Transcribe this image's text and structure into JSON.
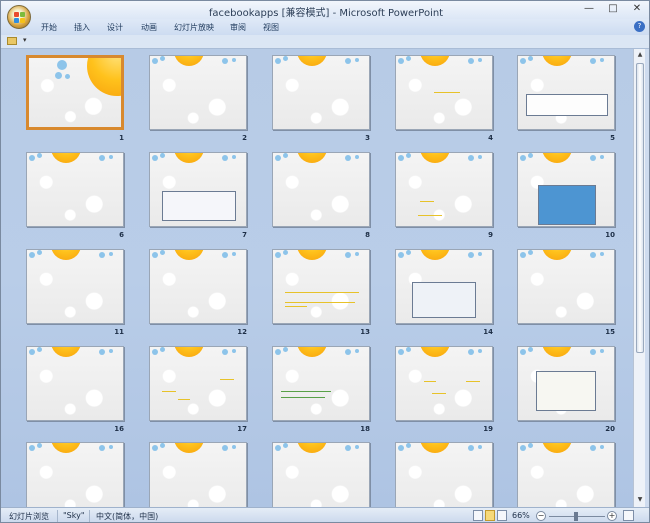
{
  "window": {
    "title": "facebookapps [兼容模式] - Microsoft PowerPoint",
    "controls": [
      "—",
      "□",
      "✕"
    ]
  },
  "ribbon": {
    "tabs": [
      "开始",
      "插入",
      "设计",
      "动画",
      "幻灯片放映",
      "审阅",
      "视图"
    ],
    "help_label": "?"
  },
  "qat": {
    "dropdown_label": "▾"
  },
  "sorter": {
    "selected": 1,
    "slides": [
      {
        "num": "1"
      },
      {
        "num": "2"
      },
      {
        "num": "3"
      },
      {
        "num": "4"
      },
      {
        "num": "5"
      },
      {
        "num": "6"
      },
      {
        "num": "7"
      },
      {
        "num": "8"
      },
      {
        "num": "9"
      },
      {
        "num": "10"
      },
      {
        "num": "11"
      },
      {
        "num": "12"
      },
      {
        "num": "13"
      },
      {
        "num": "14"
      },
      {
        "num": "15"
      },
      {
        "num": "16"
      },
      {
        "num": "17"
      },
      {
        "num": "18"
      },
      {
        "num": "19"
      },
      {
        "num": "20"
      },
      {
        "num": ""
      },
      {
        "num": ""
      },
      {
        "num": ""
      },
      {
        "num": ""
      },
      {
        "num": ""
      }
    ]
  },
  "statusbar": {
    "view": "幻灯片浏览",
    "theme": "\"Sky\"",
    "language": "中文(简体，中国)",
    "zoom": "66%",
    "zoom_out": "−",
    "zoom_in": "+"
  },
  "colors": {
    "accent_selected": "#d8892e",
    "sun": "#ffc21c",
    "bubble": "#8dc4ea"
  }
}
